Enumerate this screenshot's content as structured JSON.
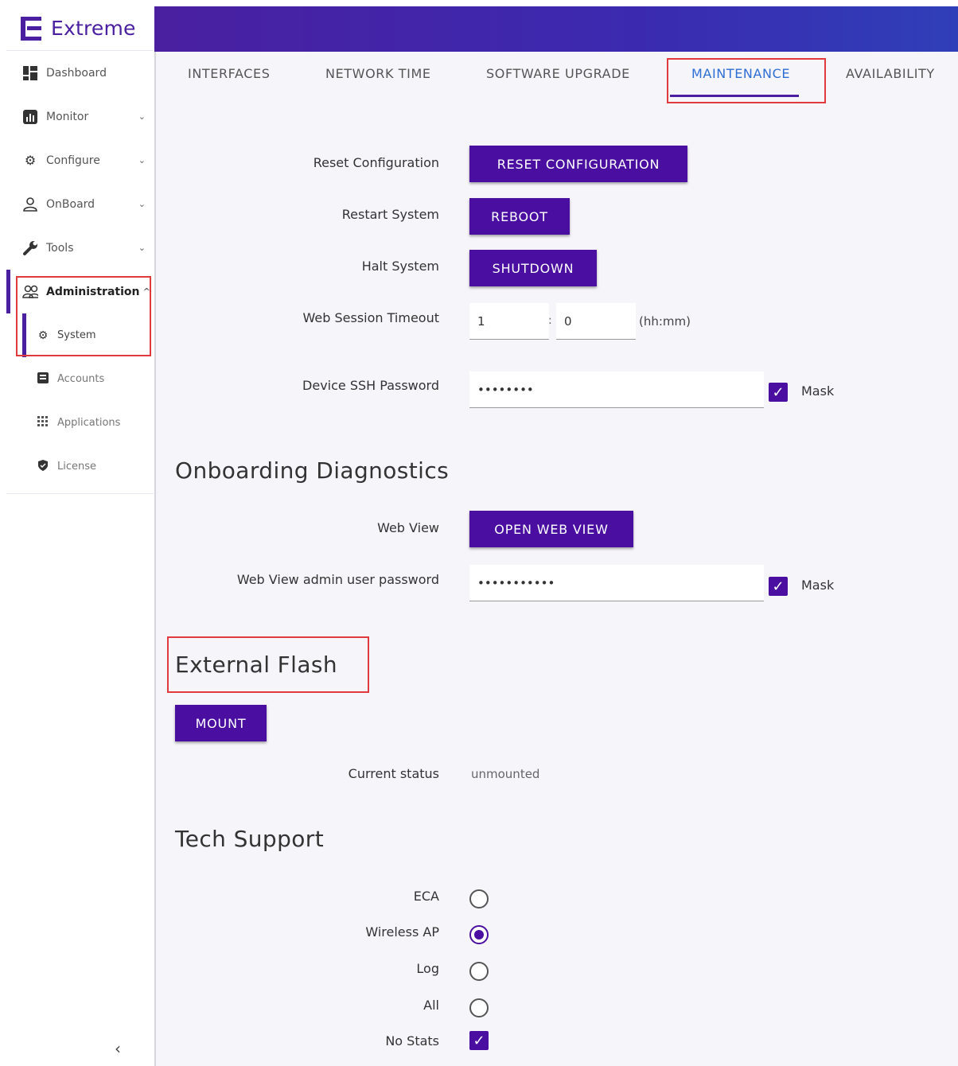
{
  "app": {
    "logo_text": "Extreme"
  },
  "sidebar": {
    "items": [
      {
        "label": "Dashboard",
        "icon": "dashboard-icon"
      },
      {
        "label": "Monitor",
        "icon": "monitor-icon"
      },
      {
        "label": "Configure",
        "icon": "gear-icon"
      },
      {
        "label": "OnBoard",
        "icon": "user-icon"
      },
      {
        "label": "Tools",
        "icon": "wrench-icon"
      },
      {
        "label": "Administration",
        "icon": "users-icon"
      }
    ],
    "sub_items": [
      {
        "label": "System",
        "icon": "gear-icon"
      },
      {
        "label": "Accounts",
        "icon": "id-card-icon"
      },
      {
        "label": "Applications",
        "icon": "grid-icon"
      },
      {
        "label": "License",
        "icon": "shield-icon"
      }
    ],
    "collapse_glyph": "‹"
  },
  "tabs": [
    {
      "label": "INTERFACES"
    },
    {
      "label": "NETWORK TIME"
    },
    {
      "label": "SOFTWARE UPGRADE"
    },
    {
      "label": "MAINTENANCE"
    },
    {
      "label": "AVAILABILITY"
    }
  ],
  "maintenance": {
    "reset_label": "Reset Configuration",
    "reset_button": "RESET CONFIGURATION",
    "restart_label": "Restart System",
    "reboot_button": "REBOOT",
    "halt_label": "Halt System",
    "shutdown_button": "SHUTDOWN",
    "timeout_label": "Web Session Timeout",
    "timeout_hours": "1",
    "timeout_minutes": "0",
    "timeout_sep": ":",
    "timeout_unit": "(hh:mm)",
    "ssh_label": "Device SSH Password",
    "ssh_value": "••••••••",
    "ssh_mask_label": "Mask"
  },
  "onboarding": {
    "title": "Onboarding Diagnostics",
    "webview_label": "Web View",
    "webview_button": "OPEN WEB VIEW",
    "admin_pw_label": "Web View admin user password",
    "admin_pw_value": "•••••••••••",
    "admin_mask_label": "Mask"
  },
  "external_flash": {
    "title": "External Flash",
    "mount_button": "MOUNT",
    "status_label": "Current status",
    "status_value": "unmounted"
  },
  "tech_support": {
    "title": "Tech Support",
    "options": [
      {
        "label": "ECA",
        "selected": false
      },
      {
        "label": "Wireless AP",
        "selected": true
      },
      {
        "label": "Log",
        "selected": false
      },
      {
        "label": "All",
        "selected": false
      }
    ],
    "no_stats_label": "No Stats",
    "no_stats_checked": true
  },
  "colors": {
    "brand": "#4a0fa0",
    "active_tab": "#2e6fd4",
    "highlight": "#e0393e"
  }
}
